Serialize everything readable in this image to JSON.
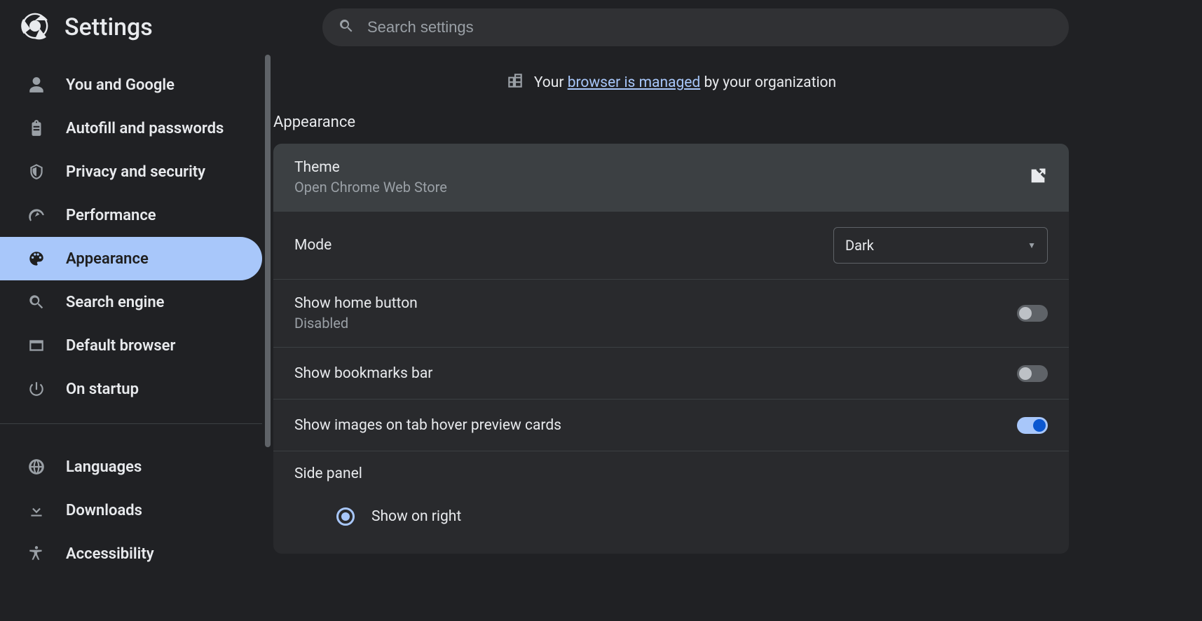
{
  "header": {
    "title": "Settings",
    "search_placeholder": "Search settings"
  },
  "managed_banner": {
    "prefix": "Your ",
    "link_text": "browser is managed",
    "suffix": " by your organization"
  },
  "sidebar": {
    "items_top": [
      {
        "id": "you-and-google",
        "label": "You and Google",
        "icon": "person"
      },
      {
        "id": "autofill",
        "label": "Autofill and passwords",
        "icon": "clipboard"
      },
      {
        "id": "privacy",
        "label": "Privacy and security",
        "icon": "shield"
      },
      {
        "id": "performance",
        "label": "Performance",
        "icon": "speed"
      },
      {
        "id": "appearance",
        "label": "Appearance",
        "icon": "palette",
        "active": true
      },
      {
        "id": "search-engine",
        "label": "Search engine",
        "icon": "search"
      },
      {
        "id": "default-browser",
        "label": "Default browser",
        "icon": "browser"
      },
      {
        "id": "on-startup",
        "label": "On startup",
        "icon": "power"
      }
    ],
    "items_bottom": [
      {
        "id": "languages",
        "label": "Languages",
        "icon": "globe"
      },
      {
        "id": "downloads",
        "label": "Downloads",
        "icon": "download"
      },
      {
        "id": "accessibility",
        "label": "Accessibility",
        "icon": "accessibility"
      }
    ]
  },
  "main": {
    "section_title": "Appearance",
    "theme": {
      "title": "Theme",
      "subtitle": "Open Chrome Web Store"
    },
    "mode": {
      "title": "Mode",
      "value": "Dark"
    },
    "home_button": {
      "title": "Show home button",
      "subtitle": "Disabled",
      "on": false
    },
    "bookmarks_bar": {
      "title": "Show bookmarks bar",
      "on": false
    },
    "tab_hover": {
      "title": "Show images on tab hover preview cards",
      "on": true
    },
    "side_panel": {
      "title": "Side panel",
      "options": [
        {
          "label": "Show on right",
          "selected": true
        }
      ]
    }
  }
}
